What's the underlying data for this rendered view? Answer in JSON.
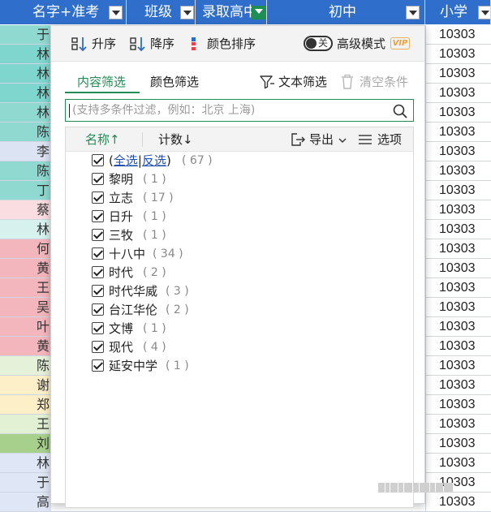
{
  "sheet": {
    "headers": [
      {
        "label": "名字+准考",
        "filtered": false
      },
      {
        "label": "班级",
        "filtered": false
      },
      {
        "label": "录取高中",
        "filtered": true
      },
      {
        "label": "初中",
        "filtered": false
      },
      {
        "label": "小学",
        "filtered": false
      }
    ],
    "rows": [
      {
        "left": "于",
        "right": "10303",
        "color": "#8fd9d1"
      },
      {
        "left": "林",
        "right": "10303",
        "color": "#7fd6cf"
      },
      {
        "left": "林",
        "right": "10303",
        "color": "#7fd6cf"
      },
      {
        "left": "林",
        "right": "10303",
        "color": "#7fd6cf"
      },
      {
        "left": "林",
        "right": "10303",
        "color": "#8fd9d1"
      },
      {
        "left": "陈",
        "right": "10303",
        "color": "#8fd9d1"
      },
      {
        "left": "李",
        "right": "10303",
        "color": "#dce3f3"
      },
      {
        "left": "陈",
        "right": "10303",
        "color": "#8fd9d1"
      },
      {
        "left": "丁",
        "right": "10303",
        "color": "#8fd9d1"
      },
      {
        "left": "蔡",
        "right": "10303",
        "color": "#fadde1"
      },
      {
        "left": "林",
        "right": "10303",
        "color": "#d7f1ef"
      },
      {
        "left": "何",
        "right": "10303",
        "color": "#f4b6bd"
      },
      {
        "left": "黄",
        "right": "10303",
        "color": "#f4b6bd"
      },
      {
        "left": "王",
        "right": "10303",
        "color": "#f4b6bd"
      },
      {
        "left": "吴",
        "right": "10303",
        "color": "#f4b6bd"
      },
      {
        "left": "叶",
        "right": "10303",
        "color": "#f4b6bd"
      },
      {
        "left": "黄",
        "right": "10303",
        "color": "#f4b6bd"
      },
      {
        "left": "陈",
        "right": "10303",
        "color": "#e6f1d9"
      },
      {
        "left": "谢",
        "right": "10303",
        "color": "#fdf0c8"
      },
      {
        "left": "郑",
        "right": "10303",
        "color": "#fdf0c8"
      },
      {
        "left": "王",
        "right": "10303",
        "color": "#e2f0d3"
      },
      {
        "left": "刘",
        "right": "10303",
        "color": "#a8d08d"
      },
      {
        "left": "林",
        "right": "10303",
        "color": "#dfe6f5"
      },
      {
        "left": "于",
        "right": "10303",
        "color": "#dfe6f5"
      },
      {
        "left": "高",
        "right": "10303",
        "color": "#dfe6f5"
      }
    ]
  },
  "popup": {
    "topbar": {
      "asc_label": "升序",
      "desc_label": "降序",
      "color_sort_label": "颜色排序",
      "toggle_state": "关",
      "advanced_label": "高级模式",
      "vip_label": "VIP"
    },
    "tabs": {
      "content_filter": "内容筛选",
      "color_filter": "颜色筛选",
      "text_filter": "文本筛选",
      "clear_conditions": "清空条件"
    },
    "search": {
      "placeholder": "(支持多条件过滤，例如：北京 上海)"
    },
    "list_header": {
      "name_label": "名称",
      "name_arrow": "↑",
      "count_label": "计数",
      "count_arrow": "↓",
      "export_label": "导出",
      "options_label": "选项"
    },
    "select_all": {
      "open": "(",
      "all": "全选",
      "sep": "|",
      "invert": "反选",
      "close": ")",
      "count": "( 67 )"
    },
    "items": [
      {
        "name": "黎明",
        "count": "( 1 )"
      },
      {
        "name": "立志",
        "count": "( 17 )"
      },
      {
        "name": "日升",
        "count": "( 1 )"
      },
      {
        "name": "三牧",
        "count": "( 1 )"
      },
      {
        "name": "十八中",
        "count": "( 34 )"
      },
      {
        "name": "时代",
        "count": "( 2 )"
      },
      {
        "name": "时代华威",
        "count": "( 3 )"
      },
      {
        "name": "台江华伦",
        "count": "( 2 )"
      },
      {
        "name": "文博",
        "count": "( 1 )"
      },
      {
        "name": "现代",
        "count": "( 4 )"
      },
      {
        "name": "延安中学",
        "count": "( 1 )"
      }
    ]
  }
}
